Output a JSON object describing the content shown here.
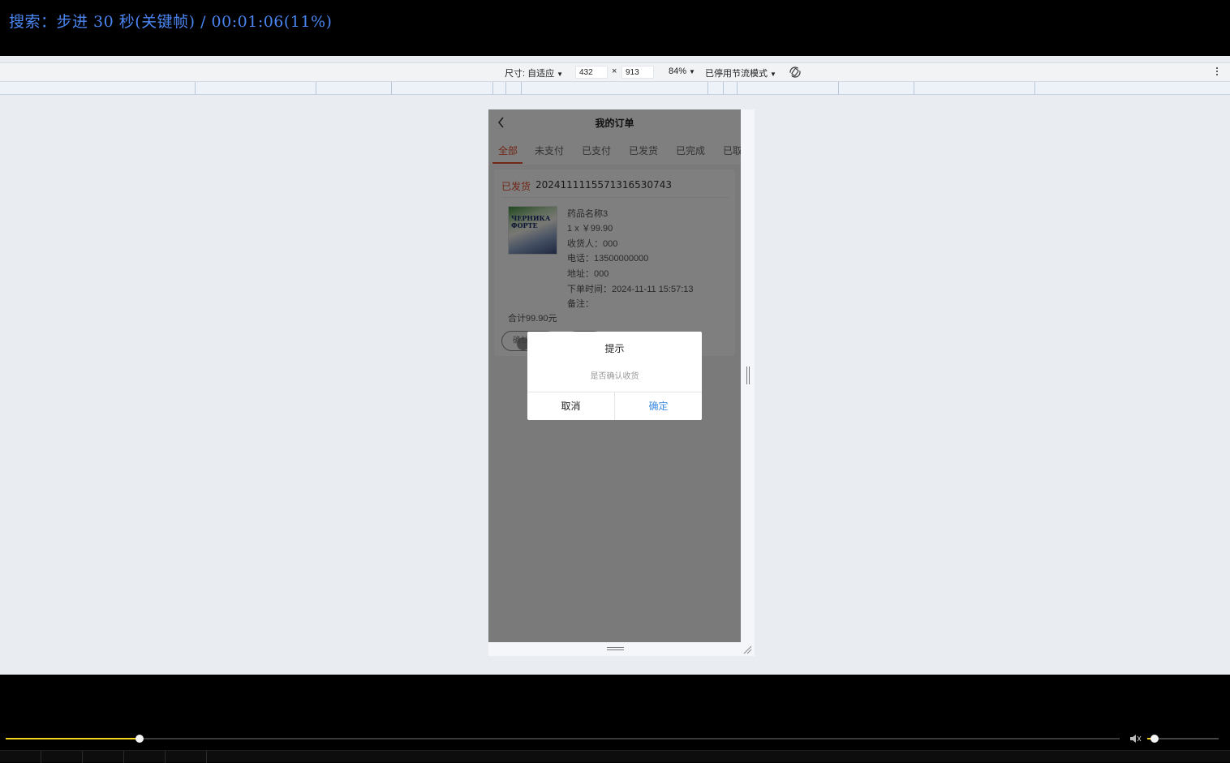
{
  "osd": {
    "text": "搜索：步进 30 秒(关键帧) / 00:01:06(11%)"
  },
  "devtools": {
    "size_label": "尺寸: 自适应",
    "width_value": "432",
    "times": "×",
    "height_value": "913",
    "zoom": "84%",
    "throttle": "已停用节流模式"
  },
  "app": {
    "title": "我的订单",
    "tabs": [
      "全部",
      "未支付",
      "已支付",
      "已发货",
      "已完成",
      "已取"
    ],
    "order": {
      "status": "已发货",
      "number": "20241111155713165307​43",
      "thumb_text": "ЧЕРНИКА ФОРТЕ",
      "name": "药品名称3",
      "qty_price": "1 x ￥99.90",
      "receiver": "收货人：000",
      "phone": "电话：13500000000",
      "address": "地址：000",
      "order_time": "下单时间：2024-11-11 15:57:13",
      "remark": "备注：",
      "total": "合计99.90元",
      "btn1": "确认收货",
      "btn2": "退款"
    },
    "dialog": {
      "title": "提示",
      "message": "是否确认收货",
      "cancel": "取消",
      "confirm": "确定"
    }
  },
  "player": {
    "progress": 0.12,
    "volume": 0.1
  }
}
